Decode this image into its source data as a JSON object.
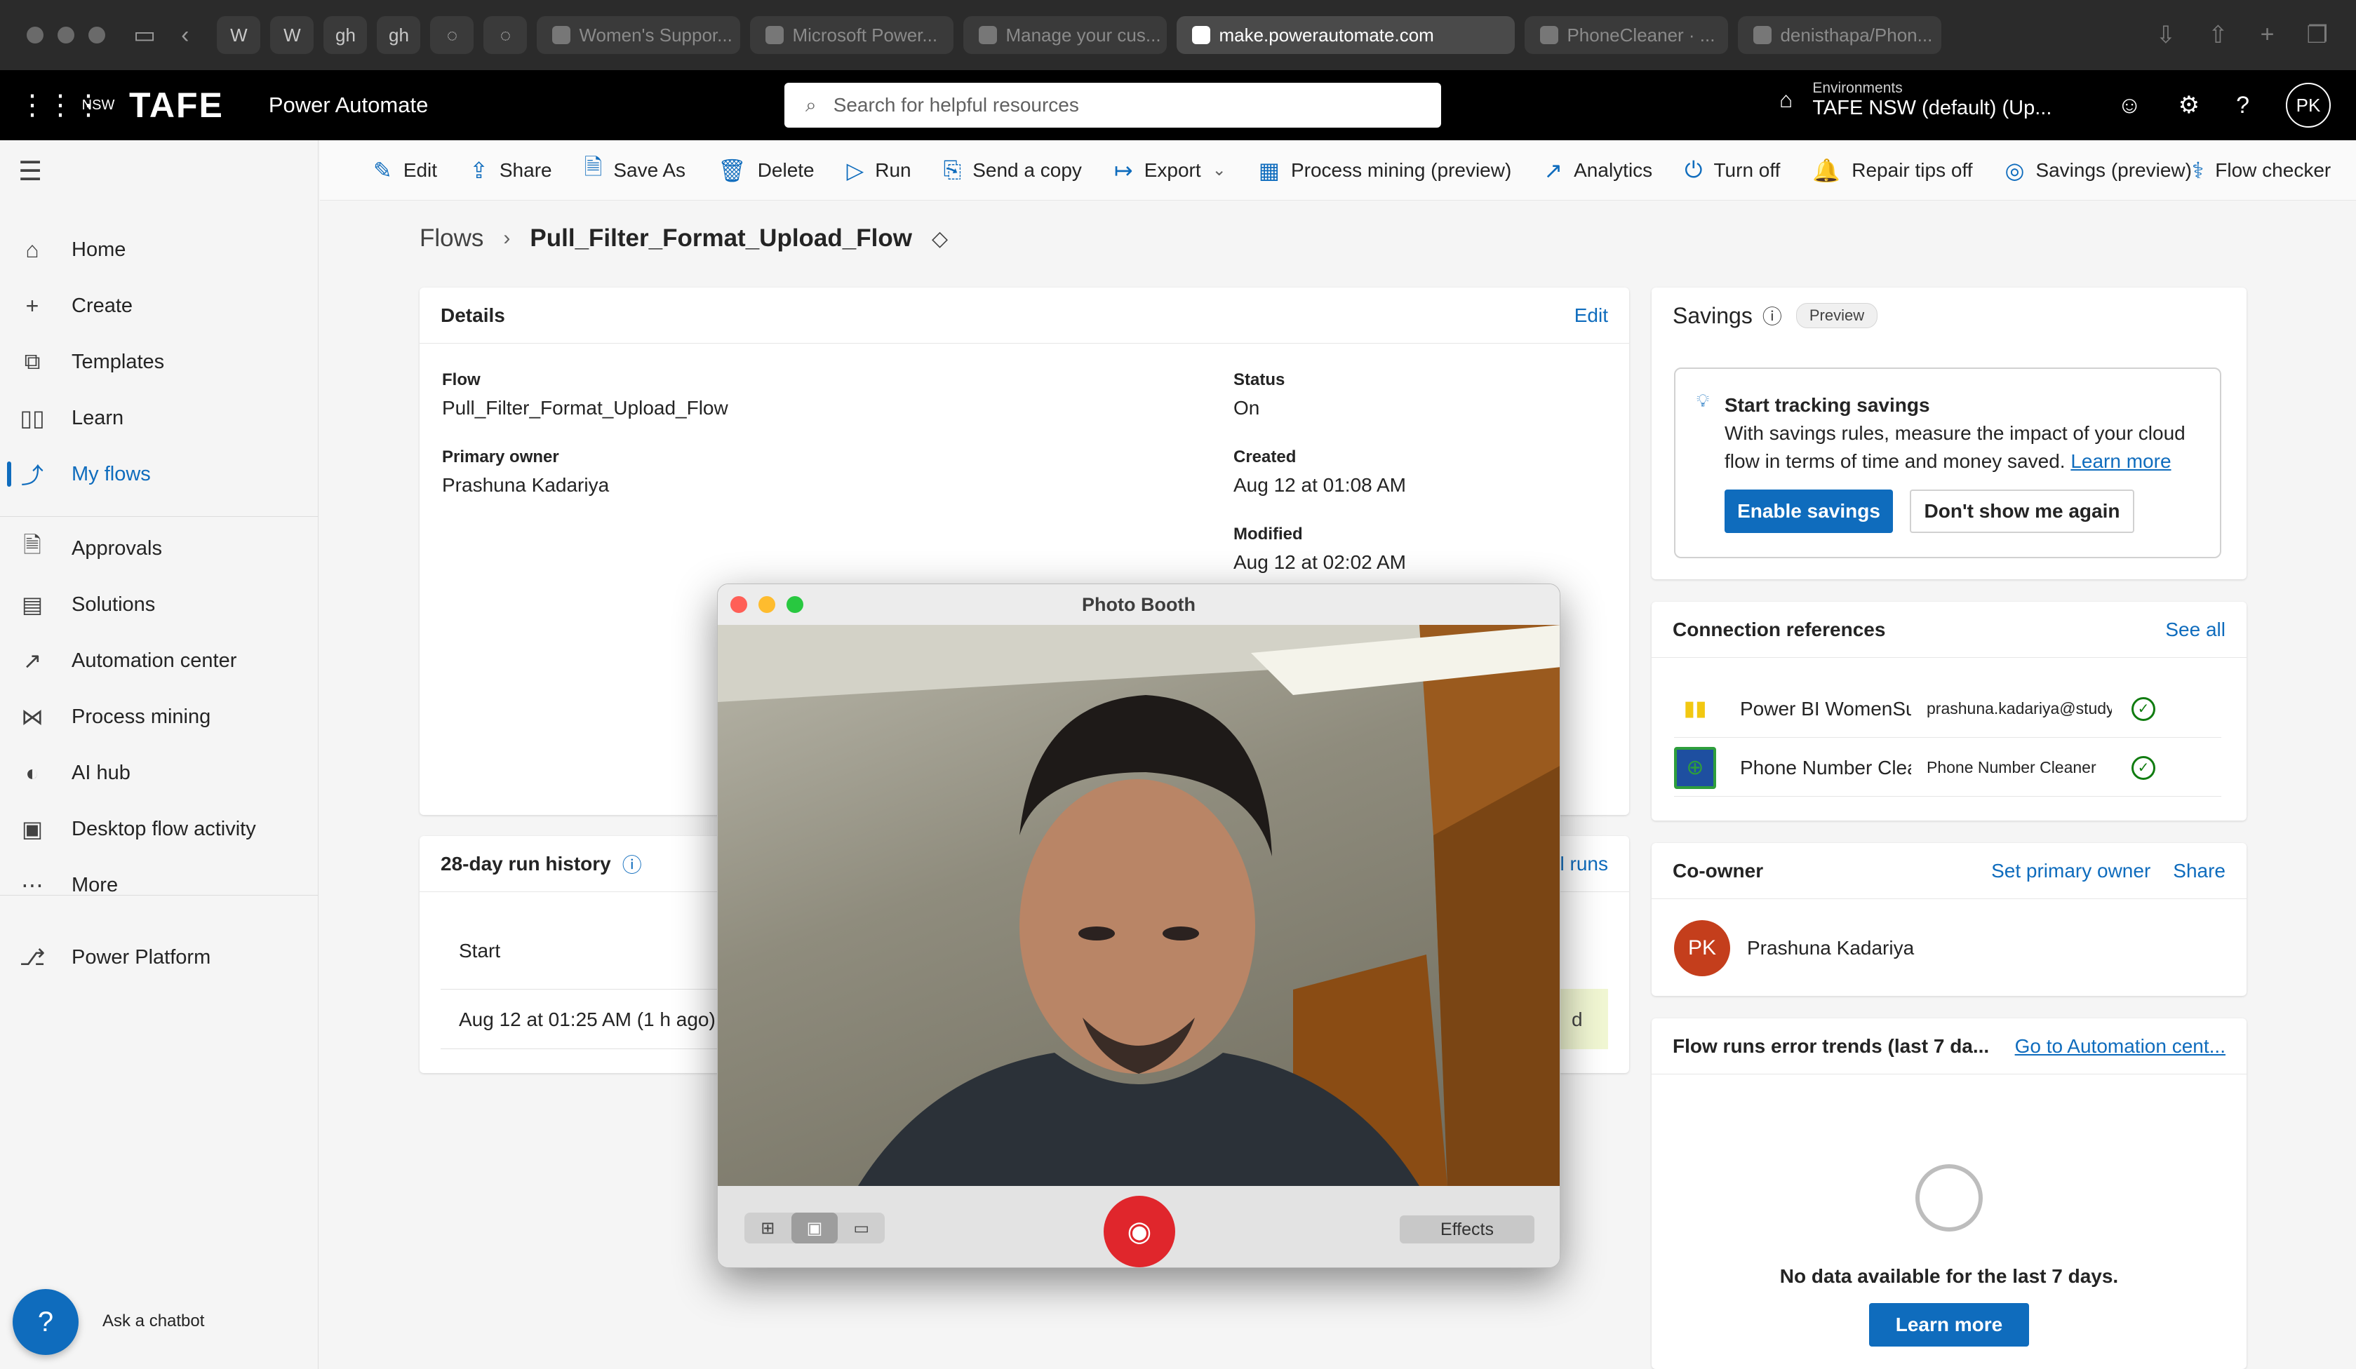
{
  "browser": {
    "tabs": [
      {
        "label": "Women's Suppor..."
      },
      {
        "label": "Microsoft Power..."
      },
      {
        "label": "Manage your cus..."
      },
      {
        "label": "make.powerautomate.com"
      },
      {
        "label": "PhoneCleaner · ..."
      },
      {
        "label": "denisthapa/Phon..."
      }
    ],
    "pinned": [
      "W",
      "W",
      "gh",
      "gh",
      "◌",
      "◌"
    ]
  },
  "header": {
    "app_name": "Power Automate",
    "logo_text": "TAFE",
    "logo_small": "NSW",
    "search_placeholder": "Search for helpful resources",
    "env_label": "Environments",
    "env_name": "TAFE NSW (default) (Up...",
    "avatar": "PK"
  },
  "nav": {
    "items": [
      {
        "label": "Home",
        "icon": "home-icon"
      },
      {
        "label": "Create",
        "icon": "plus-icon"
      },
      {
        "label": "Templates",
        "icon": "templates-icon"
      },
      {
        "label": "Learn",
        "icon": "book-icon"
      },
      {
        "label": "My flows",
        "icon": "flows-icon"
      },
      {
        "label": "Approvals",
        "icon": "approvals-icon"
      },
      {
        "label": "Solutions",
        "icon": "solutions-icon"
      },
      {
        "label": "Automation center",
        "icon": "chart-icon"
      },
      {
        "label": "Process mining",
        "icon": "process-mining-icon"
      },
      {
        "label": "AI hub",
        "icon": "ai-hub-icon"
      },
      {
        "label": "Desktop flow activity",
        "icon": "desktop-activity-icon"
      },
      {
        "label": "More",
        "icon": "more-icon"
      },
      {
        "label": "Power Platform",
        "icon": "power-platform-icon"
      }
    ],
    "chatbot_label": "Ask a chatbot"
  },
  "commands": [
    {
      "label": "Edit",
      "icon": "✎"
    },
    {
      "label": "Share",
      "icon": "⇪"
    },
    {
      "label": "Save As",
      "icon": "🗎"
    },
    {
      "label": "Delete",
      "icon": "🗑"
    },
    {
      "label": "Run",
      "icon": "▷"
    },
    {
      "label": "Send a copy",
      "icon": "⎘"
    },
    {
      "label": "Export",
      "icon": "↦"
    },
    {
      "label": "Process mining (preview)",
      "icon": "▦"
    },
    {
      "label": "Analytics",
      "icon": "↗"
    },
    {
      "label": "Turn off",
      "icon": "⏻"
    },
    {
      "label": "Repair tips off",
      "icon": "🔔"
    },
    {
      "label": "Savings (preview)",
      "icon": "◎"
    }
  ],
  "flow_checker": "Flow checker",
  "breadcrumb": {
    "root": "Flows",
    "sep": "›",
    "name": "Pull_Filter_Format_Upload_Flow"
  },
  "details": {
    "title": "Details",
    "edit": "Edit",
    "flow_label": "Flow",
    "flow_value": "Pull_Filter_Format_Upload_Flow",
    "owner_label": "Primary owner",
    "owner_value": "Prashuna Kadariya",
    "status_label": "Status",
    "status_value": "On",
    "created_label": "Created",
    "created_value": "Aug 12 at 01:08 AM",
    "modified_label": "Modified",
    "modified_value": "Aug 12 at 02:02 AM"
  },
  "run_history": {
    "title": "28-day run history",
    "all_runs_partial": "l runs",
    "col_start": "Start",
    "row_start": "Aug 12 at 01:25 AM (1 h ago)",
    "row_status_partial": "d"
  },
  "savings": {
    "title": "Savings",
    "badge": "Preview",
    "heading": "Start tracking savings",
    "body_1": "With savings rules, measure the impact of your cloud",
    "body_2": "flow in terms of time and money saved.",
    "learn_more": "Learn more",
    "enable": "Enable savings",
    "dismiss": "Don't show me again"
  },
  "connections": {
    "title": "Connection references",
    "see_all": "See all",
    "rows": [
      {
        "name": "Power BI WomenSu",
        "account": "prashuna.kadariya@studytafe",
        "icon_color": "#f2c811"
      },
      {
        "name": "Phone Number Clea",
        "account": "Phone Number Cleaner",
        "icon_color": "#2e9e3c"
      }
    ]
  },
  "coowner": {
    "title": "Co-owner",
    "set_primary": "Set primary owner",
    "share": "Share",
    "avatar": "PK",
    "name": "Prashuna Kadariya",
    "avatar_color": "#c43e1c"
  },
  "error_trends": {
    "title": "Flow runs error trends (last 7 da...",
    "link": "Go to Automation cent...",
    "empty": "No data available for the last 7 days.",
    "learn_more": "Learn more"
  },
  "photobooth": {
    "title": "Photo Booth",
    "effects": "Effects"
  },
  "colors": {
    "accent": "#0f6cbd",
    "success": "#107c10",
    "shutter": "#e0262c"
  }
}
